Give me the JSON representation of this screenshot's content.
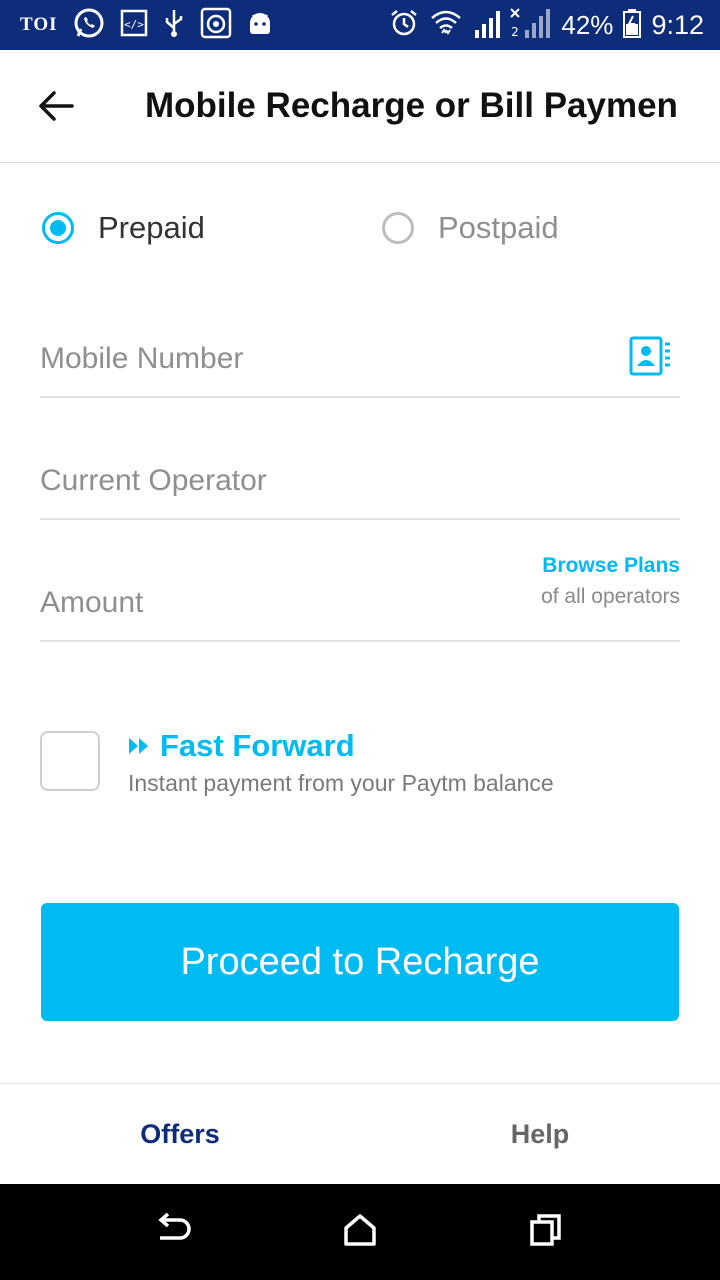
{
  "status_bar": {
    "app_label": "TOI",
    "battery": "42%",
    "time": "9:12",
    "icons": [
      "whatsapp-icon",
      "code-icon",
      "usb-icon",
      "camera-icon",
      "android-icon",
      "alarm-icon",
      "wifi-icon",
      "signal-icon",
      "battery-icon"
    ]
  },
  "header": {
    "title": "Mobile Recharge or Bill Paymen",
    "back_icon": "arrow-left-icon"
  },
  "plan_type": {
    "options": [
      {
        "label": "Prepaid",
        "selected": true
      },
      {
        "label": "Postpaid",
        "selected": false
      }
    ]
  },
  "form": {
    "mobile_placeholder": "Mobile Number",
    "mobile_value": "",
    "contact_icon": "contact-book-icon",
    "operator_placeholder": "Current Operator",
    "operator_value": "",
    "amount_placeholder": "Amount",
    "amount_value": "",
    "browse_plans_label": "Browse Plans",
    "browse_plans_sub": "of all operators"
  },
  "fast_forward": {
    "checked": false,
    "title": "Fast Forward",
    "subtitle": "Instant payment from your Paytm balance"
  },
  "proceed_label": "Proceed to Recharge",
  "bottom_tabs": [
    "Offers",
    "Help"
  ],
  "colors": {
    "accent": "#00baf2",
    "status_bar": "#0d2c7a",
    "offers_tab": "#0d2c7a"
  }
}
